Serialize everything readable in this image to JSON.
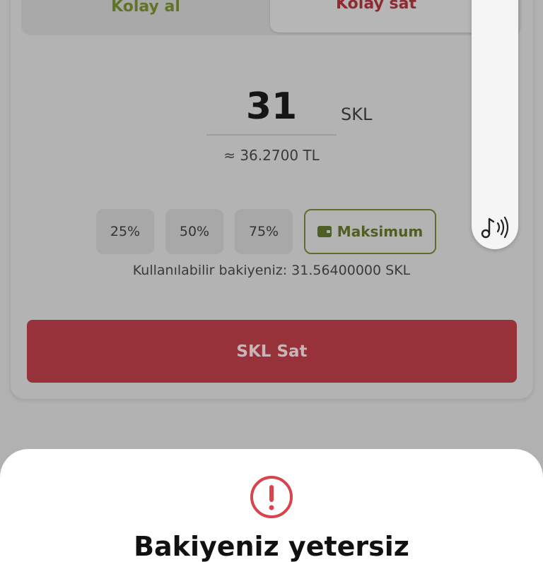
{
  "tabs": {
    "buy": "Kolay al",
    "sell": "Kolay sat"
  },
  "amount": {
    "value": "31",
    "unit": "SKL",
    "approx": "≈ 36.2700 TL"
  },
  "percent_buttons": [
    "25%",
    "50%",
    "75%"
  ],
  "max_button": {
    "label": "Maksimum",
    "icon": "wallet-icon"
  },
  "balance_text": "Kullanılabilir bakiyeniz: 31.56400000 SKL",
  "sell_button": "SKL Sat",
  "side_panel": {
    "icon": "music-sound-icon"
  },
  "sheet": {
    "icon": "alert-icon",
    "title": "Bakiyeniz yetersiz"
  },
  "colors": {
    "buy": "#5f7428",
    "sell": "#8f2a30",
    "sell_button": "#98323a",
    "alert": "#d9434b"
  }
}
